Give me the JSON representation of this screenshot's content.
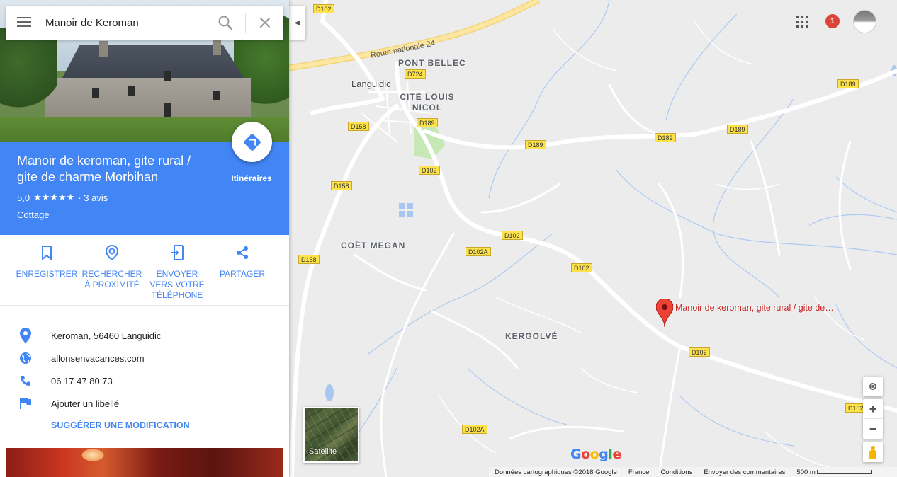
{
  "search": {
    "value": "Manoir de Keroman"
  },
  "place": {
    "title": "Manoir de keroman, gite rural / gite de charme Morbihan",
    "rating": "5,0",
    "stars": "★★★★★",
    "reviews": "· 3 avis",
    "type": "Cottage",
    "directions_label": "Itinéraires"
  },
  "actions": [
    {
      "label": "ENREGISTRER",
      "icon": "bookmark-icon"
    },
    {
      "label": "RECHERCHER À PROXIMITÉ",
      "icon": "nearby-icon"
    },
    {
      "label": "ENVOYER VERS VOTRE TÉLÉPHONE",
      "icon": "send-to-phone-icon"
    },
    {
      "label": "PARTAGER",
      "icon": "share-icon"
    }
  ],
  "info": {
    "address": "Keroman, 56460 Languidic",
    "website": "allonsenvacances.com",
    "phone": "06 17 47 80 73",
    "label": "Ajouter un libellé",
    "suggest_edit": "SUGGÉRER UNE MODIFICATION"
  },
  "map": {
    "route_nationale": "Route nationale 24",
    "places": {
      "pont_bellec": "PONT BELLEC",
      "languidic": "Languidic",
      "cite_louis_nicol": "CITÉ LOUIS NICOL",
      "coet_megan": "COËT MEGAN",
      "kergolve": "KERGOLVÉ"
    },
    "roads": {
      "d102_a": "D102",
      "d724": "D724",
      "d189_a": "D189",
      "d158_a": "D158",
      "d189_b": "D189",
      "d102_b": "D102",
      "d158_b": "D158",
      "d189_c": "D189",
      "d189_d": "D189",
      "d189_e": "D189",
      "d102_c": "D102",
      "d102a_a": "D102A",
      "d102_d": "D102",
      "d158_c": "D158",
      "d102_e": "D102",
      "d102_f": "D102",
      "d102a_b": "D102A"
    },
    "pin_label": "Manoir de keroman, gite rural / gite de…",
    "notifications": "1",
    "satellite_label": "Satellite",
    "zoom_in": "+",
    "zoom_out": "−",
    "google": [
      "G",
      "o",
      "o",
      "g",
      "l",
      "e"
    ],
    "footer": {
      "data": "Données cartographiques ©2018 Google",
      "country": "France",
      "terms": "Conditions",
      "feedback": "Envoyer des commentaires",
      "scale": "500 m"
    }
  },
  "colors": {
    "accent": "#4285f4",
    "pin": "#ea4335",
    "road_label": "#fde24a"
  }
}
